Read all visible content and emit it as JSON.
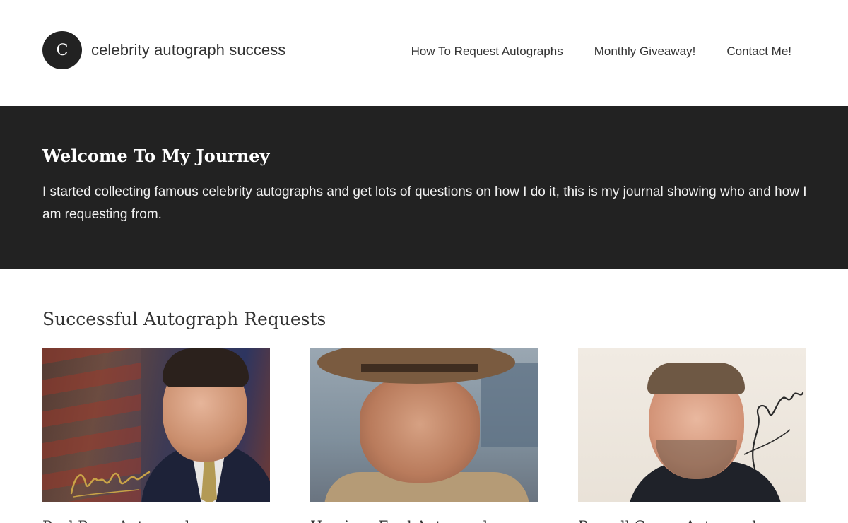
{
  "brand": {
    "initial": "C",
    "name": "celebrity autograph success"
  },
  "nav": {
    "items": [
      "How To Request Autographs",
      "Monthly Giveaway!",
      "Contact Me!"
    ]
  },
  "hero": {
    "title": "Welcome To My Journey",
    "text": "I started collecting famous celebrity autographs and get lots of questions on how I do it, this is my journal showing who and how I am requesting from."
  },
  "section": {
    "title": "Successful Autograph Requests"
  },
  "cards": [
    {
      "caption": "Paul Ryan Autograph"
    },
    {
      "caption": "Harrison Ford Autograph"
    },
    {
      "caption": "Russell Crowe Autograph"
    }
  ],
  "colors": {
    "dark": "#222222",
    "text": "#333333"
  }
}
